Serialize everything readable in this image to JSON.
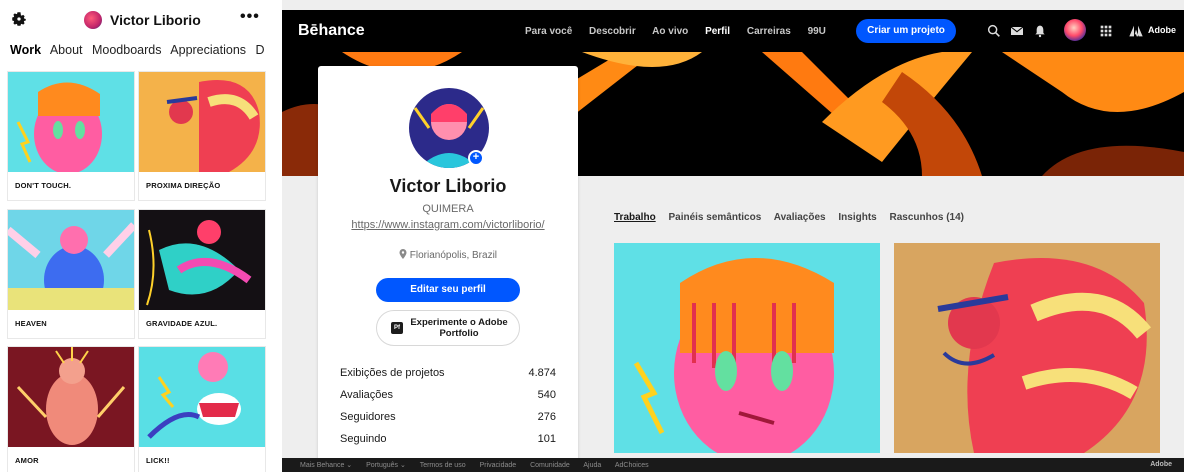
{
  "mobile": {
    "profile_name": "Victor Liborio",
    "more_label": "•••",
    "tabs": [
      "Work",
      "About",
      "Moodboards",
      "Appreciations",
      "D"
    ],
    "projects": [
      {
        "title": "DON'T TOUCH."
      },
      {
        "title": "PROXIMA DIREÇÃO"
      },
      {
        "title": "HEAVEN"
      },
      {
        "title": "GRAVIDADE AZUL."
      },
      {
        "title": "AMOR"
      },
      {
        "title": "LICK!!"
      }
    ]
  },
  "desktop": {
    "nav": {
      "logo": "Bēhance",
      "links": [
        "Para você",
        "Descobrir",
        "Ao vivo",
        "Perfil",
        "Carreiras",
        "99U"
      ],
      "create_button": "Criar um projeto",
      "adobe_label": "Adobe"
    },
    "profile": {
      "name": "Victor Liborio",
      "company": "QUIMERA",
      "url": "https://www.instagram.com/victorliborio/",
      "location": "Florianópolis, Brazil",
      "edit_button": "Editar seu perfil",
      "portfolio_button": "Experimente o Adobe Portfolio",
      "portfolio_icon_text": "Pf",
      "stats": [
        {
          "label": "Exibições de projetos",
          "value": "4.874"
        },
        {
          "label": "Avaliações",
          "value": "540"
        },
        {
          "label": "Seguidores",
          "value": "276"
        },
        {
          "label": "Seguindo",
          "value": "101"
        }
      ]
    },
    "profile_tabs": [
      "Trabalho",
      "Painéis semânticos",
      "Avaliações",
      "Insights",
      "Rascunhos (14)"
    ],
    "footer": {
      "left": [
        "Mais Behance ⌄",
        "Português ⌄",
        "Termos de uso",
        "Privacidade",
        "Comunidade",
        "Ajuda",
        "AdChoices"
      ],
      "right": "Adobe"
    }
  },
  "icons": {
    "settings": "gear-icon",
    "search": "search-icon",
    "messages": "mail-icon",
    "notifications": "bell-icon",
    "apps": "grid-icon",
    "location": "location-pin-icon",
    "adobe": "adobe-logo-icon"
  },
  "colors": {
    "accent_blue": "#0057ff",
    "nav_bg": "#000000",
    "page_bg": "#eeeeee",
    "footer_bg": "#1a1a1a"
  }
}
